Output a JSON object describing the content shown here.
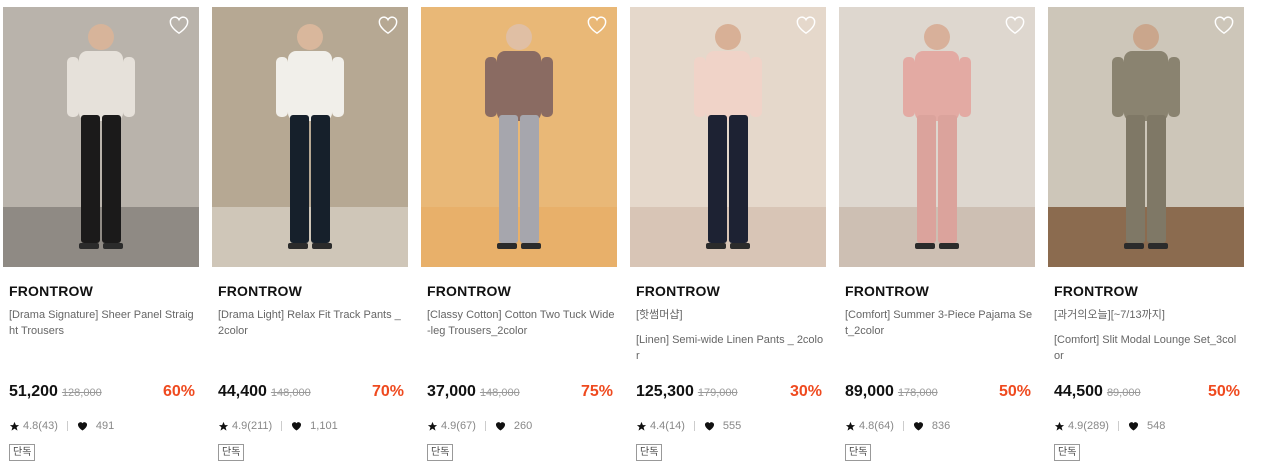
{
  "products": [
    {
      "brand": "FRONTROW",
      "promo": "",
      "name": "[Drama Signature] Sheer Panel Straight Trousers",
      "price": "51,200",
      "original_price": "128,000",
      "discount": "60%",
      "rating": "4.8(43)",
      "likes": "491",
      "badge": "단독",
      "image": {
        "bg": "#b9b3ab",
        "floor": "#8f8a84",
        "top": "#e6e1da",
        "bottom": "#1b1a1a",
        "skin": "#d7b49a"
      }
    },
    {
      "brand": "FRONTROW",
      "promo": "",
      "name": "[Drama Light] Relax Fit Track Pants _2color",
      "price": "44,400",
      "original_price": "148,000",
      "discount": "70%",
      "rating": "4.9(211)",
      "likes": "1,101",
      "badge": "단독",
      "image": {
        "bg": "#b6a893",
        "floor": "#cfc6b8",
        "top": "#f1efea",
        "bottom": "#16202b",
        "skin": "#d9b79c"
      }
    },
    {
      "brand": "FRONTROW",
      "promo": "",
      "name": "[Classy Cotton] Cotton Two Tuck Wide-leg Trousers_2color",
      "price": "37,000",
      "original_price": "148,000",
      "discount": "75%",
      "rating": "4.9(67)",
      "likes": "260",
      "badge": "단독",
      "image": {
        "bg": "#e9b877",
        "floor": "#e8b06a",
        "top": "#8a6b62",
        "bottom": "#a6a6ad",
        "skin": "#e0bfa4"
      }
    },
    {
      "brand": "FRONTROW",
      "promo": "[핫썸머샵]",
      "name": "[Linen] Semi-wide Linen Pants _ 2color",
      "price": "125,300",
      "original_price": "179,000",
      "discount": "30%",
      "rating": "4.4(14)",
      "likes": "555",
      "badge": "단독",
      "image": {
        "bg": "#e5d8cb",
        "floor": "#d8c5b6",
        "top": "#f0d3c8",
        "bottom": "#1d2233",
        "skin": "#d8b096"
      }
    },
    {
      "brand": "FRONTROW",
      "promo": "",
      "name": "[Comfort] Summer 3-Piece Pajama Set_2color",
      "price": "89,000",
      "original_price": "178,000",
      "discount": "50%",
      "rating": "4.8(64)",
      "likes": "836",
      "badge": "단독",
      "image": {
        "bg": "#ded7cf",
        "floor": "#cdbfb3",
        "top": "#e3aaa3",
        "bottom": "#dba39c",
        "skin": "#d8b09a"
      }
    },
    {
      "brand": "FRONTROW",
      "promo": "[과거의오늘][~7/13까지]",
      "name": "[Comfort] Slit Modal Lounge Set_3color",
      "price": "44,500",
      "original_price": "89,000",
      "discount": "50%",
      "rating": "4.9(289)",
      "likes": "548",
      "badge": "단독",
      "image": {
        "bg": "#cdc6b9",
        "floor": "#8b6b4f",
        "top": "#8a8370",
        "bottom": "#7f7866",
        "skin": "#caa68c"
      }
    }
  ],
  "colors": {
    "discount": "#ef4a1f",
    "strike": "#999999"
  },
  "icons": {
    "wish": "heart-outline-icon",
    "rating": "star-icon",
    "likes": "heart-filled-icon"
  }
}
